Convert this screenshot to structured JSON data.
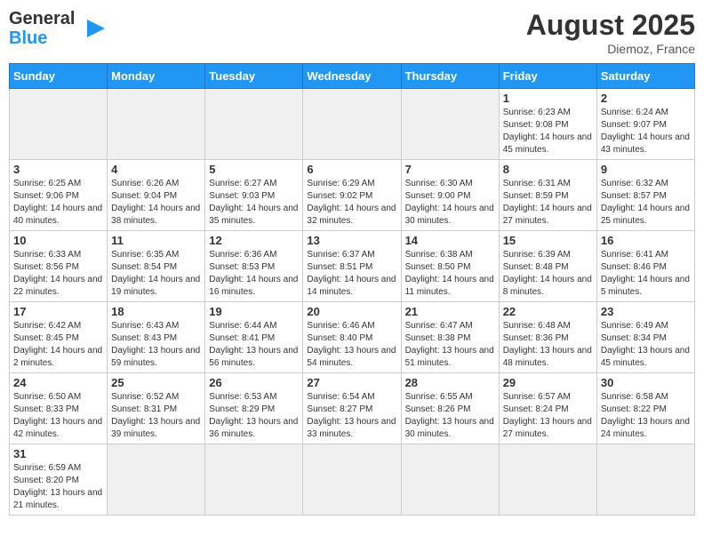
{
  "header": {
    "logo_general": "General",
    "logo_blue": "Blue",
    "month_title": "August 2025",
    "location": "Diemoz, France"
  },
  "days_of_week": [
    "Sunday",
    "Monday",
    "Tuesday",
    "Wednesday",
    "Thursday",
    "Friday",
    "Saturday"
  ],
  "weeks": [
    [
      {
        "day": "",
        "empty": true
      },
      {
        "day": "",
        "empty": true
      },
      {
        "day": "",
        "empty": true
      },
      {
        "day": "",
        "empty": true
      },
      {
        "day": "",
        "empty": true
      },
      {
        "day": "1",
        "sunrise": "6:23 AM",
        "sunset": "9:08 PM",
        "daylight": "14 hours and 45 minutes."
      },
      {
        "day": "2",
        "sunrise": "6:24 AM",
        "sunset": "9:07 PM",
        "daylight": "14 hours and 43 minutes."
      }
    ],
    [
      {
        "day": "3",
        "sunrise": "6:25 AM",
        "sunset": "9:06 PM",
        "daylight": "14 hours and 40 minutes."
      },
      {
        "day": "4",
        "sunrise": "6:26 AM",
        "sunset": "9:04 PM",
        "daylight": "14 hours and 38 minutes."
      },
      {
        "day": "5",
        "sunrise": "6:27 AM",
        "sunset": "9:03 PM",
        "daylight": "14 hours and 35 minutes."
      },
      {
        "day": "6",
        "sunrise": "6:29 AM",
        "sunset": "9:02 PM",
        "daylight": "14 hours and 32 minutes."
      },
      {
        "day": "7",
        "sunrise": "6:30 AM",
        "sunset": "9:00 PM",
        "daylight": "14 hours and 30 minutes."
      },
      {
        "day": "8",
        "sunrise": "6:31 AM",
        "sunset": "8:59 PM",
        "daylight": "14 hours and 27 minutes."
      },
      {
        "day": "9",
        "sunrise": "6:32 AM",
        "sunset": "8:57 PM",
        "daylight": "14 hours and 25 minutes."
      }
    ],
    [
      {
        "day": "10",
        "sunrise": "6:33 AM",
        "sunset": "8:56 PM",
        "daylight": "14 hours and 22 minutes."
      },
      {
        "day": "11",
        "sunrise": "6:35 AM",
        "sunset": "8:54 PM",
        "daylight": "14 hours and 19 minutes."
      },
      {
        "day": "12",
        "sunrise": "6:36 AM",
        "sunset": "8:53 PM",
        "daylight": "14 hours and 16 minutes."
      },
      {
        "day": "13",
        "sunrise": "6:37 AM",
        "sunset": "8:51 PM",
        "daylight": "14 hours and 14 minutes."
      },
      {
        "day": "14",
        "sunrise": "6:38 AM",
        "sunset": "8:50 PM",
        "daylight": "14 hours and 11 minutes."
      },
      {
        "day": "15",
        "sunrise": "6:39 AM",
        "sunset": "8:48 PM",
        "daylight": "14 hours and 8 minutes."
      },
      {
        "day": "16",
        "sunrise": "6:41 AM",
        "sunset": "8:46 PM",
        "daylight": "14 hours and 5 minutes."
      }
    ],
    [
      {
        "day": "17",
        "sunrise": "6:42 AM",
        "sunset": "8:45 PM",
        "daylight": "14 hours and 2 minutes."
      },
      {
        "day": "18",
        "sunrise": "6:43 AM",
        "sunset": "8:43 PM",
        "daylight": "13 hours and 59 minutes."
      },
      {
        "day": "19",
        "sunrise": "6:44 AM",
        "sunset": "8:41 PM",
        "daylight": "13 hours and 56 minutes."
      },
      {
        "day": "20",
        "sunrise": "6:46 AM",
        "sunset": "8:40 PM",
        "daylight": "13 hours and 54 minutes."
      },
      {
        "day": "21",
        "sunrise": "6:47 AM",
        "sunset": "8:38 PM",
        "daylight": "13 hours and 51 minutes."
      },
      {
        "day": "22",
        "sunrise": "6:48 AM",
        "sunset": "8:36 PM",
        "daylight": "13 hours and 48 minutes."
      },
      {
        "day": "23",
        "sunrise": "6:49 AM",
        "sunset": "8:34 PM",
        "daylight": "13 hours and 45 minutes."
      }
    ],
    [
      {
        "day": "24",
        "sunrise": "6:50 AM",
        "sunset": "8:33 PM",
        "daylight": "13 hours and 42 minutes."
      },
      {
        "day": "25",
        "sunrise": "6:52 AM",
        "sunset": "8:31 PM",
        "daylight": "13 hours and 39 minutes."
      },
      {
        "day": "26",
        "sunrise": "6:53 AM",
        "sunset": "8:29 PM",
        "daylight": "13 hours and 36 minutes."
      },
      {
        "day": "27",
        "sunrise": "6:54 AM",
        "sunset": "8:27 PM",
        "daylight": "13 hours and 33 minutes."
      },
      {
        "day": "28",
        "sunrise": "6:55 AM",
        "sunset": "8:26 PM",
        "daylight": "13 hours and 30 minutes."
      },
      {
        "day": "29",
        "sunrise": "6:57 AM",
        "sunset": "8:24 PM",
        "daylight": "13 hours and 27 minutes."
      },
      {
        "day": "30",
        "sunrise": "6:58 AM",
        "sunset": "8:22 PM",
        "daylight": "13 hours and 24 minutes."
      }
    ],
    [
      {
        "day": "31",
        "sunrise": "6:59 AM",
        "sunset": "8:20 PM",
        "daylight": "13 hours and 21 minutes."
      },
      {
        "day": "",
        "empty": true
      },
      {
        "day": "",
        "empty": true
      },
      {
        "day": "",
        "empty": true
      },
      {
        "day": "",
        "empty": true
      },
      {
        "day": "",
        "empty": true
      },
      {
        "day": "",
        "empty": true
      }
    ]
  ]
}
